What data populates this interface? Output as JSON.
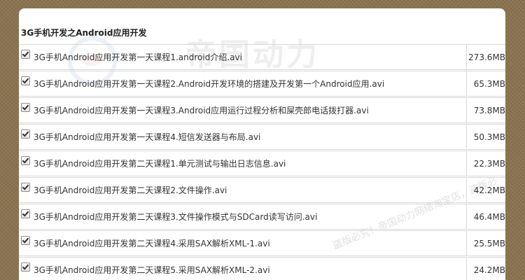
{
  "title": "3G手机开发之Android应用开发",
  "watermark": {
    "brand": "帝国动力",
    "notice": "盗版必究！帝国动力网络淘宝店，盗版必"
  },
  "files": [
    {
      "name": "3G手机Android应用开发第一天课程1.android介绍.avi",
      "size": "273.6MB",
      "checked": true
    },
    {
      "name": "3G手机Android应用开发第一天课程2.Android开发环境的搭建及开发第一个Android应用.avi",
      "size": "65.3MB",
      "checked": true
    },
    {
      "name": "3G手机Android应用开发第一天课程3.Android应用运行过程分析和屎壳郎电话拨打器.avi",
      "size": "73.8MB",
      "checked": true
    },
    {
      "name": "3G手机Android应用开发第一天课程4.短信发送器与布局.avi",
      "size": "50.3MB",
      "checked": true
    },
    {
      "name": "3G手机Android应用开发第二天课程1.单元测试与输出日志信息.avi",
      "size": "22.3MB",
      "checked": true
    },
    {
      "name": "3G手机Android应用开发第二天课程2.文件操作.avi",
      "size": "42.2MB",
      "checked": true
    },
    {
      "name": "3G手机Android应用开发第二天课程3.文件操作模式与SDCard读写访问.avi",
      "size": "46.4MB",
      "checked": true
    },
    {
      "name": "3G手机Android应用开发第二天课程4.采用SAX解析XML-1.avi",
      "size": "25.5MB",
      "checked": true
    },
    {
      "name": "3G手机Android应用开发第二天课程5.采用SAX解析XML-2.avi",
      "size": "24.2MB",
      "checked": true
    }
  ]
}
